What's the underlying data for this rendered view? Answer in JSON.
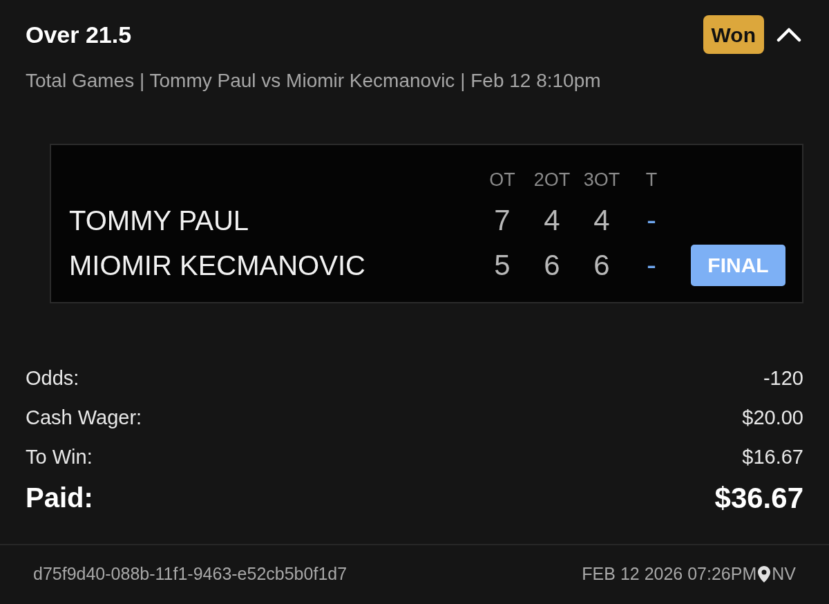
{
  "bet": {
    "title": "Over 21.5",
    "status": {
      "label": "Won",
      "kind": "won"
    },
    "expanded": true,
    "subtitle": "Total Games | Tommy Paul vs Miomir Kecmanovic | Feb 12 8:10pm"
  },
  "scoreboard": {
    "columns": [
      {
        "label": "OT",
        "kind": "set"
      },
      {
        "label": "2OT",
        "kind": "set"
      },
      {
        "label": "3OT",
        "kind": "set"
      },
      {
        "label": "T",
        "kind": "total"
      }
    ],
    "players": [
      {
        "name": "TOMMY PAUL",
        "scores": [
          "7",
          "4",
          "4",
          "-"
        ]
      },
      {
        "name": "MIOMIR KECMANOVIC",
        "scores": [
          "5",
          "6",
          "6",
          "-"
        ]
      }
    ],
    "status": "FINAL"
  },
  "details": [
    {
      "label": "Odds:",
      "value": "-120",
      "kind": "line"
    },
    {
      "label": "Cash Wager:",
      "value": "$20.00",
      "kind": "line"
    },
    {
      "label": "To Win:",
      "value": "$16.67",
      "kind": "line"
    },
    {
      "label": "Paid:",
      "value": "$36.67",
      "kind": "total"
    }
  ],
  "footer": {
    "id": "d75f9d40-088b-11f1-9463-e52cb5b0f1d7",
    "timestamp": "FEB 12 2026 07:26PM",
    "location": "NV"
  }
}
